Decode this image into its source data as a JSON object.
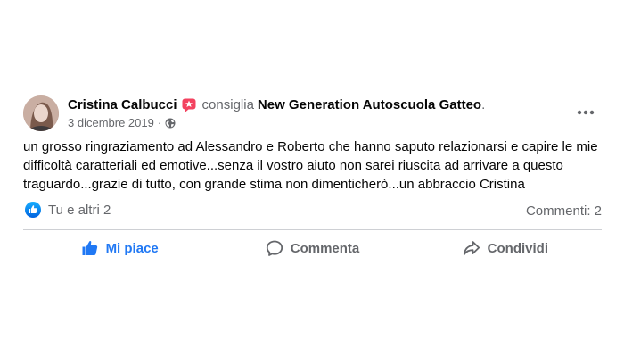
{
  "post": {
    "author": "Cristina Calbucci",
    "action_text": "consiglia",
    "page_name": "New Generation Autoscuola Gatteo",
    "trailing_punct": ".",
    "date": "3 dicembre 2019",
    "meta_separator": "·",
    "body": "un grosso ringraziamento ad Alessandro e Roberto che hanno saputo relazionarsi e capire le mie difficoltà caratteriali ed emotive...senza il vostro aiuto non sarei riuscita ad arrivare a questo traguardo...grazie di tutto, con grande stima non dimenticherò...un abbraccio Cristina"
  },
  "reactions": {
    "summary": "Tu e altri 2",
    "comments": "Commenti: 2"
  },
  "actions": {
    "like": "Mi piace",
    "comment": "Commenta",
    "share": "Condividi"
  },
  "icons": {
    "reaction": "like-icon",
    "badge": "recommend-star-icon",
    "privacy": "globe-icon",
    "more": "more-options-icon"
  },
  "colors": {
    "accent": "#2078f4",
    "badge": "#f3425f",
    "secondary_text": "#65676b",
    "primary_text": "#050505",
    "divider": "#ced0d4"
  }
}
